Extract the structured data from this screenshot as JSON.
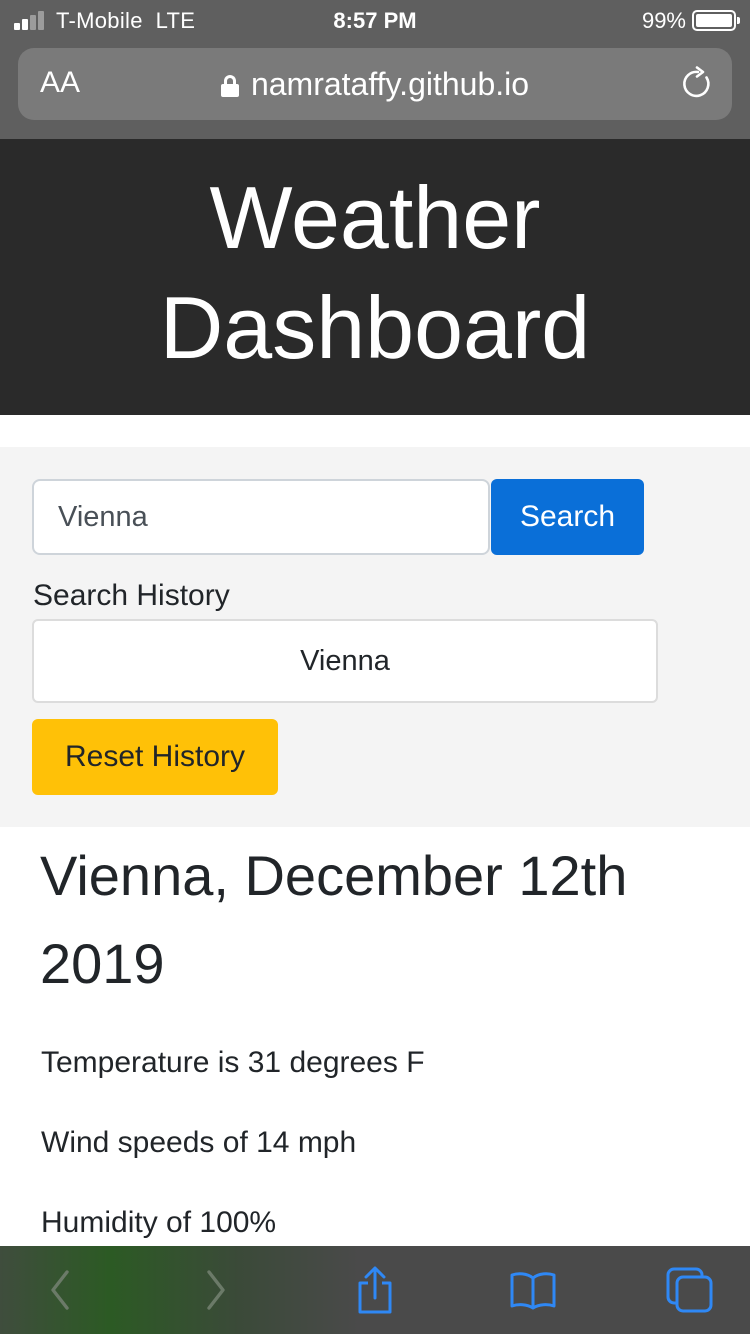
{
  "status_bar": {
    "carrier": "T-Mobile",
    "network": "LTE",
    "time": "8:57 PM",
    "battery": "99%"
  },
  "browser": {
    "text_size_label": "AA",
    "url": "namrataffy.github.io"
  },
  "header": {
    "title": "Weather Dashboard"
  },
  "search": {
    "input_value": "Vienna",
    "button_label": "Search"
  },
  "history": {
    "label": "Search History",
    "items": [
      "Vienna"
    ],
    "reset_label": "Reset History"
  },
  "weather": {
    "heading": "Vienna, December 12th 2019",
    "temperature": "Temperature is 31 degrees F",
    "wind": "Wind speeds of 14 mph",
    "humidity": "Humidity of 100%"
  },
  "toolbar": {
    "icons": [
      "back-icon",
      "forward-icon",
      "share-icon",
      "bookmarks-icon",
      "tabs-icon"
    ]
  },
  "colors": {
    "header_bg": "#2a2a2a",
    "search_button": "#0a6fd8",
    "reset_button": "#ffc107",
    "toolbar_icon": "#2f88f5",
    "toolbar_icon_disabled": "#6b7a68"
  }
}
